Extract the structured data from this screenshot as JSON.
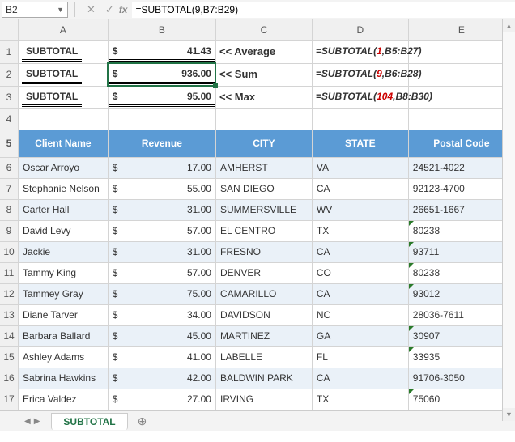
{
  "namebox": {
    "value": "B2"
  },
  "formula_bar": {
    "value": "=SUBTOTAL(9,B7:B29)"
  },
  "top_rows": [
    {
      "row": "1",
      "label": "SUBTOTAL",
      "value": "41.43",
      "arrow_text": "<<  Average",
      "formula_pre": "=SUBTOTAL(",
      "formula_arg": "1",
      "formula_post": ",B5:B27)"
    },
    {
      "row": "2",
      "label": "SUBTOTAL",
      "value": "936.00",
      "arrow_text": "<<  Sum",
      "formula_pre": "=SUBTOTAL(",
      "formula_arg": "9",
      "formula_post": ",B6:B28)"
    },
    {
      "row": "3",
      "label": "SUBTOTAL",
      "value": "95.00",
      "arrow_text": "<<  Max",
      "formula_pre": "=SUBTOTAL(",
      "formula_arg": "104",
      "formula_post": ",B8:B30)"
    }
  ],
  "columns": [
    "A",
    "B",
    "C",
    "D",
    "E"
  ],
  "table_headers": {
    "row": "5",
    "client": "Client Name",
    "revenue": "Revenue",
    "city": "CITY",
    "state": "STATE",
    "postal": "Postal Code"
  },
  "data_rows": [
    {
      "row": "6",
      "client": "Oscar Arroyo",
      "revenue": "17.00",
      "city": "AMHERST",
      "state": "VA",
      "postal": "24521-4022",
      "tick": false
    },
    {
      "row": "7",
      "client": "Stephanie Nelson",
      "revenue": "55.00",
      "city": "SAN DIEGO",
      "state": "CA",
      "postal": "92123-4700",
      "tick": false
    },
    {
      "row": "8",
      "client": "Carter Hall",
      "revenue": "31.00",
      "city": "SUMMERSVILLE",
      "state": "WV",
      "postal": "26651-1667",
      "tick": false
    },
    {
      "row": "9",
      "client": "David Levy",
      "revenue": "57.00",
      "city": "EL CENTRO",
      "state": "TX",
      "postal": "80238",
      "tick": true
    },
    {
      "row": "10",
      "client": "Jackie",
      "revenue": "31.00",
      "city": "FRESNO",
      "state": "CA",
      "postal": "93711",
      "tick": true
    },
    {
      "row": "11",
      "client": "Tammy King",
      "revenue": "57.00",
      "city": "DENVER",
      "state": "CO",
      "postal": "80238",
      "tick": true
    },
    {
      "row": "12",
      "client": "Tammey Gray",
      "revenue": "75.00",
      "city": "CAMARILLO",
      "state": "CA",
      "postal": "93012",
      "tick": true
    },
    {
      "row": "13",
      "client": "Diane Tarver",
      "revenue": "34.00",
      "city": "DAVIDSON",
      "state": "NC",
      "postal": "28036-7611",
      "tick": false
    },
    {
      "row": "14",
      "client": "Barbara Ballard",
      "revenue": "45.00",
      "city": "MARTINEZ",
      "state": "GA",
      "postal": "30907",
      "tick": true
    },
    {
      "row": "15",
      "client": "Ashley Adams",
      "revenue": "41.00",
      "city": "LABELLE",
      "state": "FL",
      "postal": "33935",
      "tick": true
    },
    {
      "row": "16",
      "client": "Sabrina Hawkins",
      "revenue": "42.00",
      "city": "BALDWIN PARK",
      "state": "CA",
      "postal": "91706-3050",
      "tick": false
    },
    {
      "row": "17",
      "client": "Erica Valdez",
      "revenue": "27.00",
      "city": "IRVING",
      "state": "TX",
      "postal": "75060",
      "tick": true
    }
  ],
  "empty_row": {
    "row": "4"
  },
  "sheet_tab": {
    "label": "SUBTOTAL"
  },
  "dollar": "$",
  "fx_cancel": "✕",
  "fx_confirm": "✓",
  "fx_label": "fx"
}
